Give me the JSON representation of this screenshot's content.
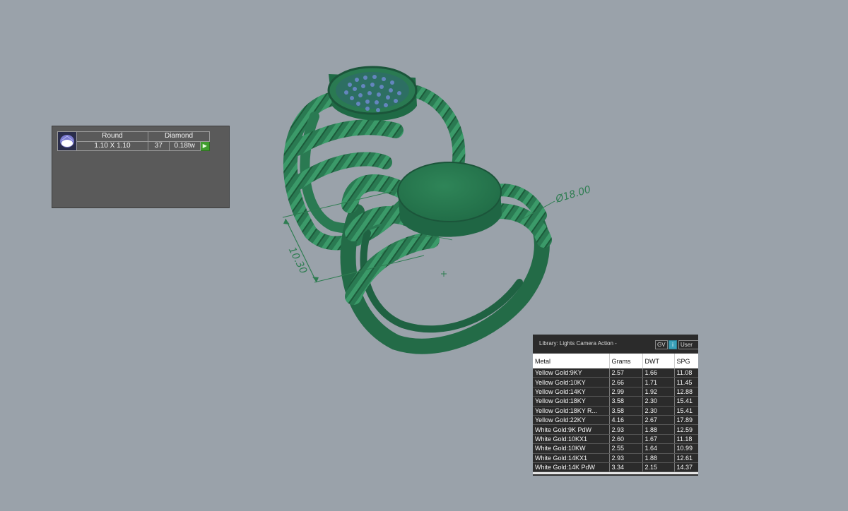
{
  "viewport": {
    "background": "#9aa2aa",
    "model_color": "#2a7a52",
    "dimension_diameter": "Ø18.00",
    "dimension_height": "10.30"
  },
  "gem_panel": {
    "icon": "round-gem-icon",
    "shape": "Round",
    "material": "Diamond",
    "size": "1.10 X 1.10",
    "count": "37",
    "weight": "0.18tw",
    "play_icon": "play-icon"
  },
  "metal_panel": {
    "title": "Library: Lights Camera Action -",
    "buttons": {
      "gv": "GV",
      "info": "i",
      "user": "User"
    },
    "columns": [
      "Metal",
      "Grams",
      "DWT",
      "SPG"
    ],
    "rows": [
      [
        "Yellow Gold:9KY",
        "2.57",
        "1.66",
        "11.08"
      ],
      [
        "Yellow Gold:10KY",
        "2.66",
        "1.71",
        "11.45"
      ],
      [
        "Yellow Gold:14KY",
        "2.99",
        "1.92",
        "12.88"
      ],
      [
        "Yellow Gold:18KY",
        "3.58",
        "2.30",
        "15.41"
      ],
      [
        "Yellow Gold:18KY R...",
        "3.58",
        "2.30",
        "15.41"
      ],
      [
        "Yellow Gold:22KY",
        "4.16",
        "2.67",
        "17.89"
      ],
      [
        "White Gold:9K PdW",
        "2.93",
        "1.88",
        "12.59"
      ],
      [
        "White Gold:10KX1",
        "2.60",
        "1.67",
        "11.18"
      ],
      [
        "White Gold:10KW",
        "2.55",
        "1.64",
        "10.99"
      ],
      [
        "White Gold:14KX1",
        "2.93",
        "1.88",
        "12.61"
      ],
      [
        "White Gold:14K PdW",
        "3.34",
        "2.15",
        "14.37"
      ]
    ]
  }
}
